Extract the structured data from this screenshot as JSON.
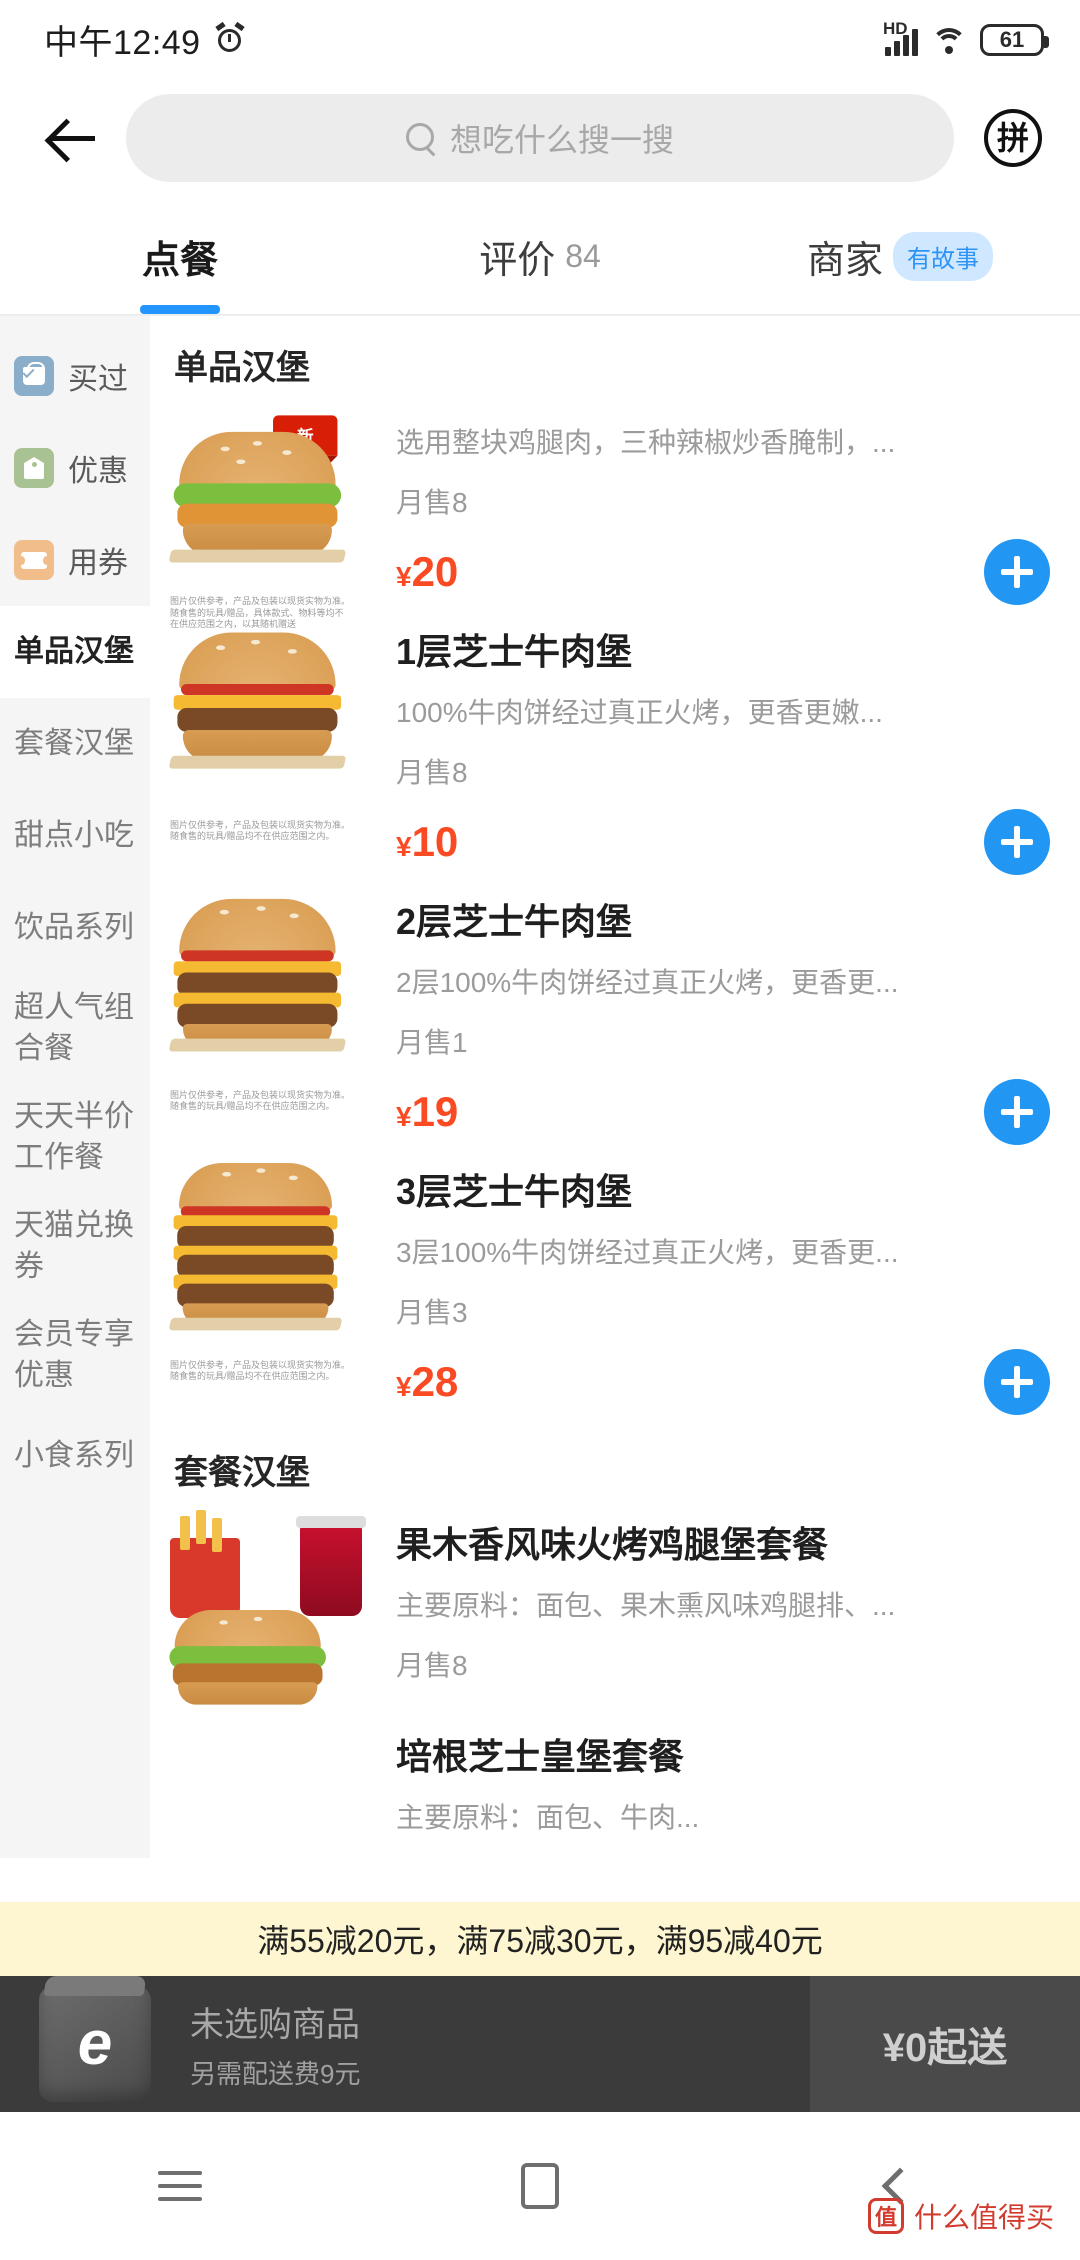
{
  "status_bar": {
    "time": "中午12:49",
    "alarm_icon": "alarm-icon",
    "network_label": "HD",
    "signal_icon": "signal-bars-icon",
    "wifi_icon": "wifi-icon",
    "battery_level": "61"
  },
  "header": {
    "back_icon": "back-arrow-icon",
    "search_icon": "search-icon",
    "search_placeholder": "想吃什么搜一搜",
    "search_value": "",
    "pin_button_label": "拼"
  },
  "tabs": [
    {
      "label": "点餐",
      "count": "",
      "badge": "",
      "active": true
    },
    {
      "label": "评价",
      "count": "84",
      "badge": "",
      "active": false
    },
    {
      "label": "商家",
      "count": "",
      "badge": "有故事",
      "active": false
    }
  ],
  "sidebar": {
    "quick_items": [
      {
        "label": "买过",
        "icon": "shopping-bag-check-icon",
        "color": "#8aadc9"
      },
      {
        "label": "优惠",
        "icon": "discount-tag-icon",
        "color": "#a9c293"
      },
      {
        "label": "用券",
        "icon": "coupon-ticket-icon",
        "color": "#f0bd8b"
      }
    ],
    "categories": [
      {
        "label": "单品汉堡",
        "active": true
      },
      {
        "label": "套餐汉堡",
        "active": false
      },
      {
        "label": "甜点小吃",
        "active": false
      },
      {
        "label": "饮品系列",
        "active": false
      },
      {
        "label": "超人气组合餐",
        "active": false
      },
      {
        "label": "天天半价工作餐",
        "active": false
      },
      {
        "label": "天猫兑换券",
        "active": false
      },
      {
        "label": "会员专享优惠",
        "active": false
      },
      {
        "label": "小食系列",
        "active": false
      }
    ]
  },
  "menu": {
    "sections": [
      {
        "title": "单品汉堡",
        "items": [
          {
            "name": "",
            "desc": "选用整块鸡腿肉，三种辣椒炒香腌制，...",
            "sales": "月售8",
            "currency": "¥",
            "price": "20",
            "badge": "新",
            "fineprint": "图片仅供参考，产品及包装以现货实物为准。随食售的玩具/赠品，具体款式、物料等均不在供应范围之内，以其随机赠送",
            "add_label": "+"
          },
          {
            "name": "1层芝士牛肉堡",
            "desc": "100%牛肉饼经过真正火烤，更香更嫩...",
            "sales": "月售8",
            "currency": "¥",
            "price": "10",
            "badge": "",
            "fineprint": "图片仅供参考，产品及包装以现货实物为准。随食售的玩具/赠品均不在供应范围之内。",
            "add_label": "+"
          },
          {
            "name": "2层芝士牛肉堡",
            "desc": "2层100%牛肉饼经过真正火烤，更香更...",
            "sales": "月售1",
            "currency": "¥",
            "price": "19",
            "badge": "",
            "fineprint": "图片仅供参考，产品及包装以现货实物为准。随食售的玩具/赠品均不在供应范围之内。",
            "add_label": "+"
          },
          {
            "name": "3层芝士牛肉堡",
            "desc": "3层100%牛肉饼经过真正火烤，更香更...",
            "sales": "月售3",
            "currency": "¥",
            "price": "28",
            "badge": "",
            "fineprint": "图片仅供参考，产品及包装以现货实物为准。随食售的玩具/赠品均不在供应范围之内。",
            "add_label": "+"
          }
        ]
      },
      {
        "title": "套餐汉堡",
        "items": [
          {
            "name": "果木香风味火烤鸡腿堡套餐",
            "desc": "主要原料：面包、果木熏风味鸡腿排、...",
            "sales": "月售8",
            "currency": "¥",
            "price": "",
            "badge": "",
            "fineprint": "",
            "add_label": "+"
          },
          {
            "name": "培根芝士皇堡套餐",
            "desc": "主要原料：面包、牛肉...",
            "sales": "",
            "currency": "¥",
            "price": "",
            "badge": "",
            "fineprint": "",
            "add_label": "+"
          }
        ]
      }
    ]
  },
  "promo_banner": {
    "text": "满55减20元，满75减30元，满95减40元"
  },
  "cart": {
    "icon": "cart-box-icon",
    "empty_text": "未选购商品",
    "delivery_fee_text": "另需配送费9元",
    "action_label": "¥0起送"
  },
  "nav_bar": {
    "menu_icon": "menu-icon",
    "home_icon": "home-icon",
    "back_icon": "back-icon"
  },
  "watermark": {
    "logo": "值",
    "text": "什么值得买"
  },
  "colors": {
    "accent_blue": "#2196f3",
    "price_red": "#fa4a23",
    "promo_yellow": "#fdf6d0",
    "cart_dark": "#3b3b3b",
    "badge_blue_bg": "#cfe8ff"
  }
}
